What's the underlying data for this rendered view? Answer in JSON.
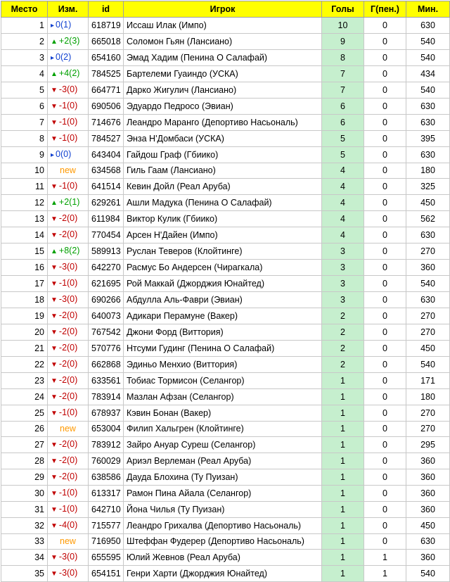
{
  "headers": {
    "place": "Место",
    "change": "Изм.",
    "id": "id",
    "player": "Игрок",
    "goals": "Голы",
    "pen": "Г(пен.)",
    "mins": "Мин."
  },
  "colors": {
    "header_bg": "#ffff00",
    "goals_highlight": "#c6efce",
    "up": "#00a000",
    "down": "#c00000",
    "same": "#1040d0",
    "new": "#ff9900"
  },
  "rows": [
    {
      "place": "1",
      "dir": "same",
      "change": "0(1)",
      "id": "618719",
      "player": "Иссаш Илак (Импо)",
      "goals": "10",
      "pen": "0",
      "mins": "630",
      "hl": true
    },
    {
      "place": "2",
      "dir": "up",
      "change": "+2(3)",
      "id": "665018",
      "player": "Соломон Гьян (Лансиано)",
      "goals": "9",
      "pen": "0",
      "mins": "540",
      "hl": true
    },
    {
      "place": "3",
      "dir": "same",
      "change": "0(2)",
      "id": "654160",
      "player": "Эмад Хадим (Пенина О Салафай)",
      "goals": "8",
      "pen": "0",
      "mins": "540",
      "hl": true
    },
    {
      "place": "4",
      "dir": "up",
      "change": "+4(2)",
      "id": "784525",
      "player": "Бартелеми Гуаиндо (УСКА)",
      "goals": "7",
      "pen": "0",
      "mins": "434",
      "hl": true
    },
    {
      "place": "5",
      "dir": "down",
      "change": "-3(0)",
      "id": "664771",
      "player": "Дарко Жигулич (Лансиано)",
      "goals": "7",
      "pen": "0",
      "mins": "540",
      "hl": true
    },
    {
      "place": "6",
      "dir": "down",
      "change": "-1(0)",
      "id": "690506",
      "player": "Эдуардо Педросо (Эвиан)",
      "goals": "6",
      "pen": "0",
      "mins": "630",
      "hl": true
    },
    {
      "place": "7",
      "dir": "down",
      "change": "-1(0)",
      "id": "714676",
      "player": "Леандро Маранго (Депортиво Насьональ)",
      "goals": "6",
      "pen": "0",
      "mins": "630",
      "hl": true
    },
    {
      "place": "8",
      "dir": "down",
      "change": "-1(0)",
      "id": "784527",
      "player": "Энза Н'Домбаси (УСКА)",
      "goals": "5",
      "pen": "0",
      "mins": "395",
      "hl": true
    },
    {
      "place": "9",
      "dir": "same",
      "change": "0(0)",
      "id": "643404",
      "player": "Гайдош Граф (Гбиико)",
      "goals": "5",
      "pen": "0",
      "mins": "630",
      "hl": true
    },
    {
      "place": "10",
      "dir": "new",
      "change": "new",
      "id": "634568",
      "player": "Гиль Гаам (Лансиано)",
      "goals": "4",
      "pen": "0",
      "mins": "180",
      "hl": true
    },
    {
      "place": "11",
      "dir": "down",
      "change": "-1(0)",
      "id": "641514",
      "player": "Кевин Дойл (Реал Аруба)",
      "goals": "4",
      "pen": "0",
      "mins": "325",
      "hl": true
    },
    {
      "place": "12",
      "dir": "up",
      "change": "+2(1)",
      "id": "629261",
      "player": "Ашли Мадука (Пенина О Салафай)",
      "goals": "4",
      "pen": "0",
      "mins": "450",
      "hl": true
    },
    {
      "place": "13",
      "dir": "down",
      "change": "-2(0)",
      "id": "611984",
      "player": "Виктор Кулик (Гбиико)",
      "goals": "4",
      "pen": "0",
      "mins": "562",
      "hl": true
    },
    {
      "place": "14",
      "dir": "down",
      "change": "-2(0)",
      "id": "770454",
      "player": "Арсен Н'Дайен (Импо)",
      "goals": "4",
      "pen": "0",
      "mins": "630",
      "hl": true
    },
    {
      "place": "15",
      "dir": "up",
      "change": "+8(2)",
      "id": "589913",
      "player": "Руслан Теверов (Клойтинге)",
      "goals": "3",
      "pen": "0",
      "mins": "270",
      "hl": true
    },
    {
      "place": "16",
      "dir": "down",
      "change": "-3(0)",
      "id": "642270",
      "player": "Расмус Бо Андерсен (Чирагкала)",
      "goals": "3",
      "pen": "0",
      "mins": "360",
      "hl": true
    },
    {
      "place": "17",
      "dir": "down",
      "change": "-1(0)",
      "id": "621695",
      "player": "Рой Маккай (Джорджия Юнайтед)",
      "goals": "3",
      "pen": "0",
      "mins": "540",
      "hl": true
    },
    {
      "place": "18",
      "dir": "down",
      "change": "-3(0)",
      "id": "690266",
      "player": "Абдулла Аль-Фаври (Эвиан)",
      "goals": "3",
      "pen": "0",
      "mins": "630",
      "hl": true
    },
    {
      "place": "19",
      "dir": "down",
      "change": "-2(0)",
      "id": "640073",
      "player": "Адикари Перамуне (Вакер)",
      "goals": "2",
      "pen": "0",
      "mins": "270",
      "hl": true
    },
    {
      "place": "20",
      "dir": "down",
      "change": "-2(0)",
      "id": "767542",
      "player": "Джони Форд (Виттория)",
      "goals": "2",
      "pen": "0",
      "mins": "270",
      "hl": true
    },
    {
      "place": "21",
      "dir": "down",
      "change": "-2(0)",
      "id": "570776",
      "player": "Нтсуми Гудинг (Пенина О Салафай)",
      "goals": "2",
      "pen": "0",
      "mins": "450",
      "hl": true
    },
    {
      "place": "22",
      "dir": "down",
      "change": "-2(0)",
      "id": "662868",
      "player": "Эдиньо Менхио (Виттория)",
      "goals": "2",
      "pen": "0",
      "mins": "540",
      "hl": true
    },
    {
      "place": "23",
      "dir": "down",
      "change": "-2(0)",
      "id": "633561",
      "player": "Тобиас Тормисон (Селангор)",
      "goals": "1",
      "pen": "0",
      "mins": "171",
      "hl": true
    },
    {
      "place": "24",
      "dir": "down",
      "change": "-2(0)",
      "id": "783914",
      "player": "Мазлан Афзан (Селангор)",
      "goals": "1",
      "pen": "0",
      "mins": "180",
      "hl": true
    },
    {
      "place": "25",
      "dir": "down",
      "change": "-1(0)",
      "id": "678937",
      "player": "Кэвин Бонан (Вакер)",
      "goals": "1",
      "pen": "0",
      "mins": "270",
      "hl": true
    },
    {
      "place": "26",
      "dir": "new",
      "change": "new",
      "id": "653004",
      "player": "Филип Хальгрен (Клойтинге)",
      "goals": "1",
      "pen": "0",
      "mins": "270",
      "hl": true
    },
    {
      "place": "27",
      "dir": "down",
      "change": "-2(0)",
      "id": "783912",
      "player": "Зайро Ануар Суреш (Селангор)",
      "goals": "1",
      "pen": "0",
      "mins": "295",
      "hl": true
    },
    {
      "place": "28",
      "dir": "down",
      "change": "-2(0)",
      "id": "760029",
      "player": "Ариэл Верлеман (Реал Аруба)",
      "goals": "1",
      "pen": "0",
      "mins": "360",
      "hl": true
    },
    {
      "place": "29",
      "dir": "down",
      "change": "-2(0)",
      "id": "638586",
      "player": "Дауда Блохина (Ту Пуизан)",
      "goals": "1",
      "pen": "0",
      "mins": "360",
      "hl": true
    },
    {
      "place": "30",
      "dir": "down",
      "change": "-1(0)",
      "id": "613317",
      "player": "Рамон Пина Айала (Селангор)",
      "goals": "1",
      "pen": "0",
      "mins": "360",
      "hl": true
    },
    {
      "place": "31",
      "dir": "down",
      "change": "-1(0)",
      "id": "642710",
      "player": "Йона Чилья (Ту Пуизан)",
      "goals": "1",
      "pen": "0",
      "mins": "360",
      "hl": true
    },
    {
      "place": "32",
      "dir": "down",
      "change": "-4(0)",
      "id": "715577",
      "player": "Леандро Грихалва (Депортиво Насьональ)",
      "goals": "1",
      "pen": "0",
      "mins": "450",
      "hl": true
    },
    {
      "place": "33",
      "dir": "new",
      "change": "new",
      "id": "716950",
      "player": "Штеффан Фудерер (Депортиво Насьональ)",
      "goals": "1",
      "pen": "0",
      "mins": "630",
      "hl": true
    },
    {
      "place": "34",
      "dir": "down",
      "change": "-3(0)",
      "id": "655595",
      "player": "Юлий Жевнов (Реал Аруба)",
      "goals": "1",
      "pen": "1",
      "mins": "360",
      "hl": true
    },
    {
      "place": "35",
      "dir": "down",
      "change": "-3(0)",
      "id": "654151",
      "player": "Генри Харти (Джорджия Юнайтед)",
      "goals": "1",
      "pen": "1",
      "mins": "540",
      "hl": true
    }
  ]
}
